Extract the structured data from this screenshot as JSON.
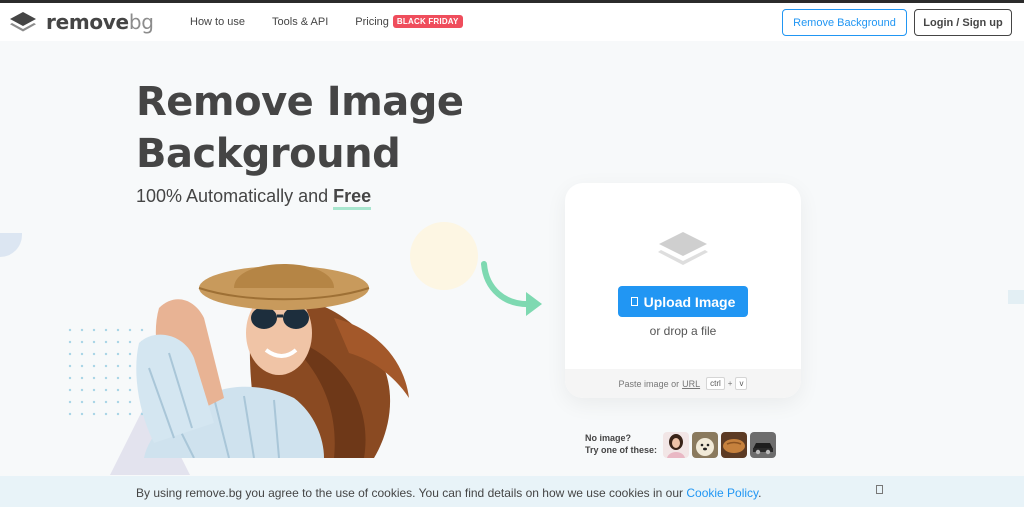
{
  "header": {
    "logo_text": "remove",
    "logo_suffix": "bg",
    "nav": {
      "how_to_use": "How to use",
      "tools_api": "Tools & API",
      "pricing": "Pricing",
      "pricing_badge": "BLACK FRIDAY"
    },
    "remove_background_button": "Remove Background",
    "login_button": "Login / Sign up"
  },
  "hero": {
    "title_line1": "Remove Image",
    "title_line2": "Background",
    "subtitle_prefix": "100% Automatically and",
    "subtitle_highlight": "Free"
  },
  "upload": {
    "button_label": "Upload Image",
    "drop_text": "or drop a file",
    "paste_text": "Paste image or",
    "paste_url": "URL",
    "key_ctrl": "ctrl",
    "key_plus": "+",
    "key_v": "v"
  },
  "samples": {
    "line1": "No image?",
    "line2": "Try one of these:"
  },
  "cookie": {
    "text": "By using remove.bg you agree to the use of cookies. You can find details on how we use cookies in our",
    "link": "Cookie Policy",
    "period": "."
  },
  "colors": {
    "accent": "#2196f3",
    "badge": "#ef4d5c",
    "highlight": "#a8e6cf",
    "arrow": "#7ed9b1"
  }
}
